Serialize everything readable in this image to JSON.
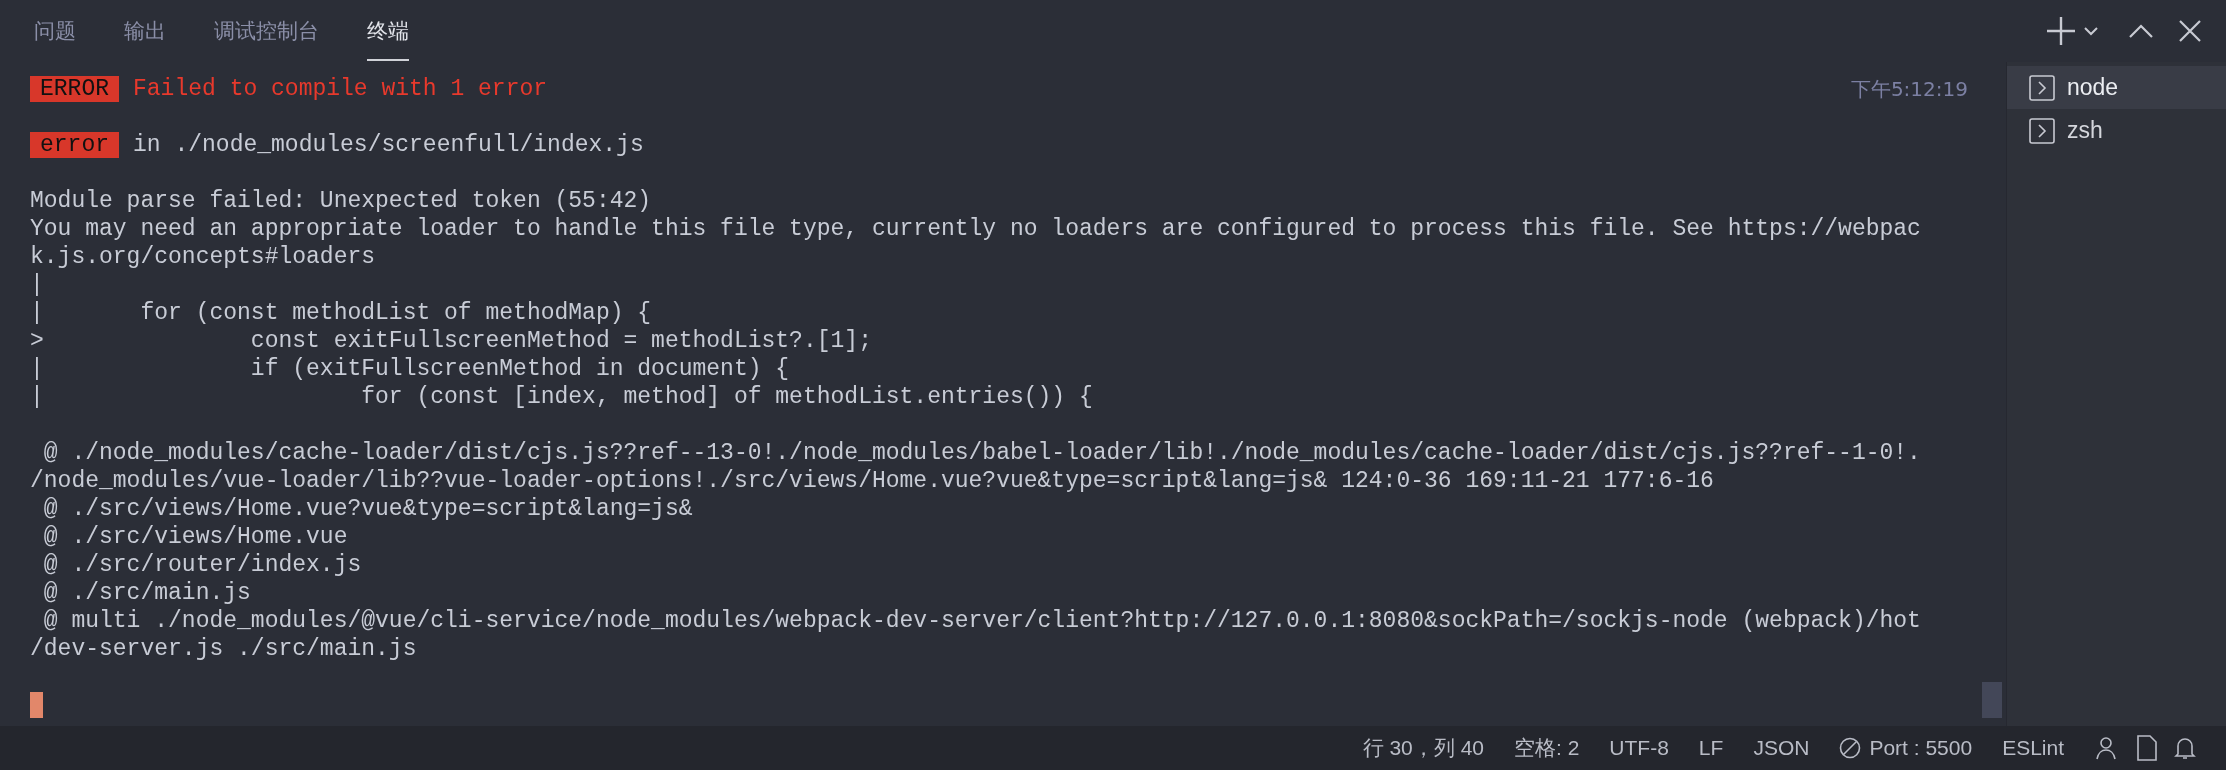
{
  "tabs": [
    {
      "label": "问题",
      "selected": false
    },
    {
      "label": "输出",
      "selected": false
    },
    {
      "label": "调试控制台",
      "selected": false
    },
    {
      "label": "终端",
      "selected": true
    }
  ],
  "terminal": {
    "lines": [
      {
        "kind": "banner",
        "badge": "ERROR",
        "text": "Failed to compile with 1 error",
        "time": "下午5:12:19"
      },
      {
        "kind": "blank"
      },
      {
        "kind": "badge",
        "badge": "error",
        "text": "in ./node_modules/screenfull/index.js"
      },
      {
        "kind": "blank"
      },
      {
        "kind": "text",
        "text": "Module parse failed: Unexpected token (55:42)"
      },
      {
        "kind": "text",
        "text": "You may need an appropriate loader to handle this file type, currently no loaders are configured to process this file. See https://webpac"
      },
      {
        "kind": "text",
        "text": "k.js.org/concepts#loaders"
      },
      {
        "kind": "text",
        "text": "|"
      },
      {
        "kind": "text",
        "text": "|       for (const methodList of methodMap) {"
      },
      {
        "kind": "text",
        "text": ">               const exitFullscreenMethod = methodList?.[1];"
      },
      {
        "kind": "text",
        "text": "|               if (exitFullscreenMethod in document) {"
      },
      {
        "kind": "text",
        "text": "|                       for (const [index, method] of methodList.entries()) {"
      },
      {
        "kind": "blank"
      },
      {
        "kind": "text",
        "text": " @ ./node_modules/cache-loader/dist/cjs.js??ref--13-0!./node_modules/babel-loader/lib!./node_modules/cache-loader/dist/cjs.js??ref--1-0!."
      },
      {
        "kind": "text",
        "text": "/node_modules/vue-loader/lib??vue-loader-options!./src/views/Home.vue?vue&type=script&lang=js& 124:0-36 169:11-21 177:6-16"
      },
      {
        "kind": "text",
        "text": " @ ./src/views/Home.vue?vue&type=script&lang=js&"
      },
      {
        "kind": "text",
        "text": " @ ./src/views/Home.vue"
      },
      {
        "kind": "text",
        "text": " @ ./src/router/index.js"
      },
      {
        "kind": "text",
        "text": " @ ./src/main.js"
      },
      {
        "kind": "text",
        "text": " @ multi ./node_modules/@vue/cli-service/node_modules/webpack-dev-server/client?http://127.0.0.1:8080&sockPath=/sockjs-node (webpack)/hot"
      },
      {
        "kind": "text",
        "text": "/dev-server.js ./src/main.js"
      },
      {
        "kind": "blank"
      },
      {
        "kind": "cursor"
      }
    ]
  },
  "terminal_list": [
    {
      "name": "node",
      "selected": true
    },
    {
      "name": "zsh",
      "selected": false
    }
  ],
  "status_bar": [
    {
      "kind": "text",
      "text": "行 30，列 40"
    },
    {
      "kind": "text",
      "text": "空格: 2"
    },
    {
      "kind": "text",
      "text": "UTF-8"
    },
    {
      "kind": "text",
      "text": "LF"
    },
    {
      "kind": "text",
      "text": "JSON"
    },
    {
      "kind": "port",
      "text": "Port : 5500"
    },
    {
      "kind": "text",
      "text": "ESLint"
    }
  ]
}
